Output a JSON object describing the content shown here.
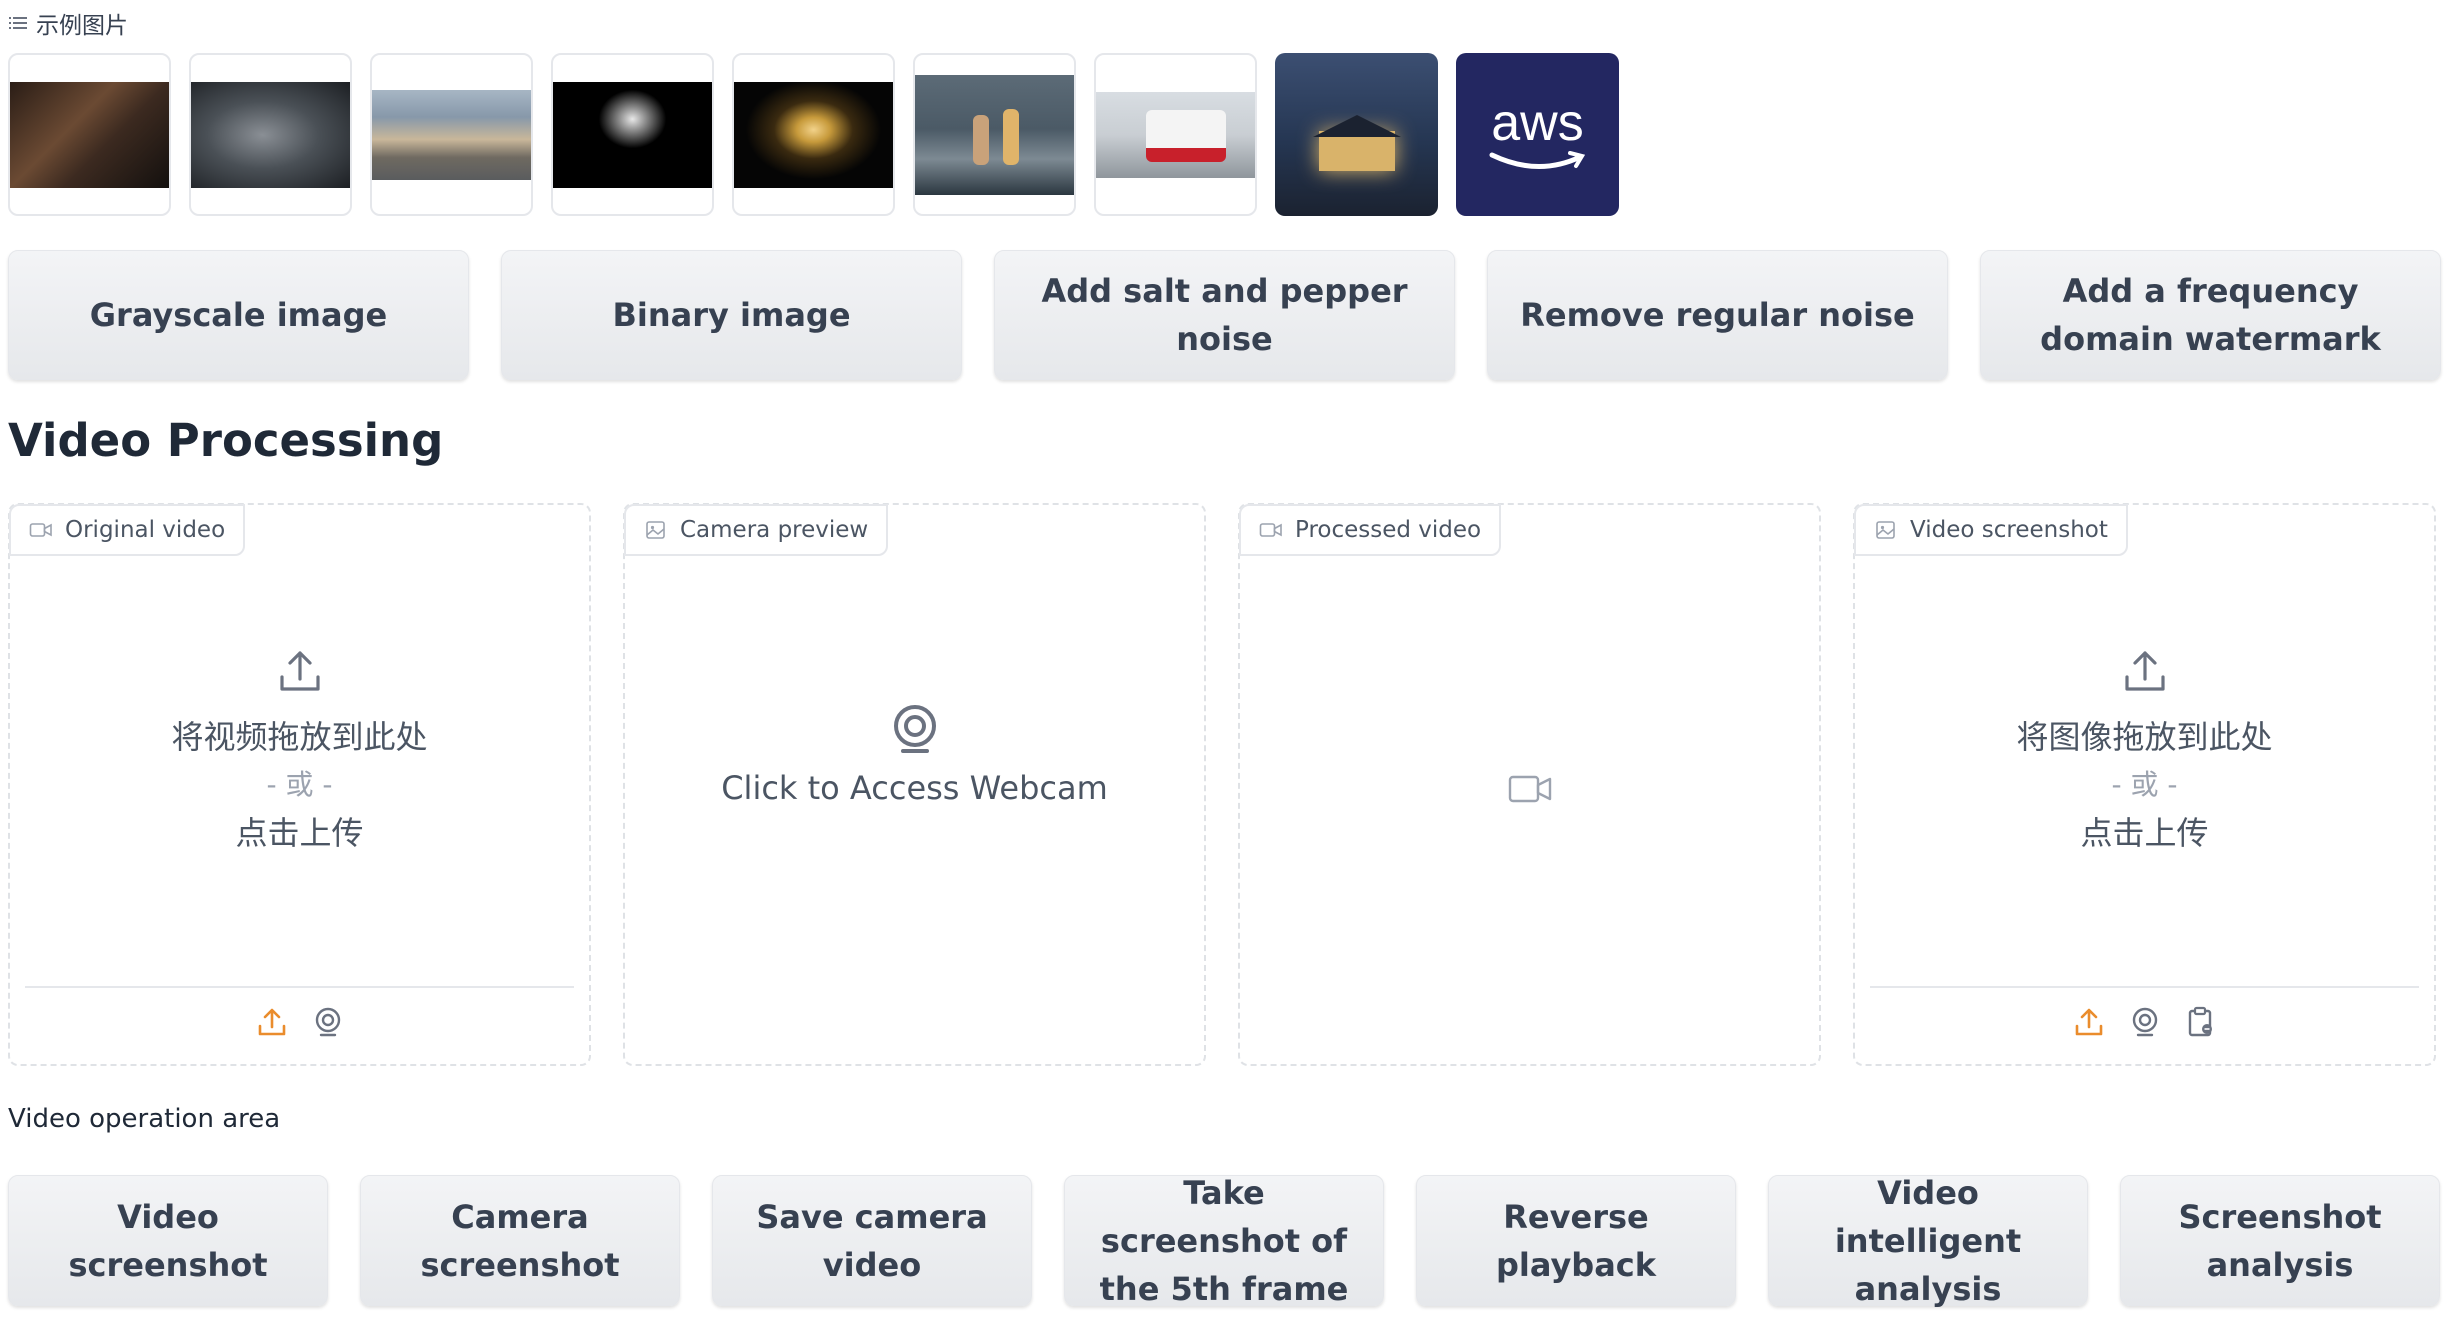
{
  "examples": {
    "label": "示例图片",
    "thumbnails": [
      {
        "name": "dark-room-photo",
        "colors": [
          "#2a1d16",
          "#6b4a33",
          "#13100e"
        ]
      },
      {
        "name": "map-photo",
        "colors": [
          "#3a3f45",
          "#8a8f95",
          "#1c1f23"
        ]
      },
      {
        "name": "city-photo",
        "colors": [
          "#8798aa",
          "#c9b79a",
          "#5a5c5e"
        ]
      },
      {
        "name": "flower-xray-photo",
        "colors": [
          "#000000",
          "#e8e8e8",
          "#000000"
        ]
      },
      {
        "name": "glass-photo",
        "colors": [
          "#050505",
          "#c79a3b",
          "#050505"
        ]
      },
      {
        "name": "toys-photo",
        "colors": [
          "#4b5a66",
          "#c9a27a",
          "#2b3740"
        ]
      },
      {
        "name": "tram-photo",
        "colors": [
          "#c9ced3",
          "#c8202b",
          "#8f969c"
        ]
      },
      {
        "name": "house-night-photo",
        "colors": [
          "#253652",
          "#d9b36a",
          "#1b2230"
        ]
      },
      {
        "name": "aws-logo",
        "text": "aws",
        "colors": [
          "#232761"
        ]
      }
    ]
  },
  "image_buttons": [
    {
      "label": "Grayscale image"
    },
    {
      "label": "Binary image"
    },
    {
      "label": "Add salt and pepper noise"
    },
    {
      "label": "Remove regular noise"
    },
    {
      "label": "Add a frequency domain watermark"
    }
  ],
  "video_section": {
    "title": "Video Processing",
    "panels": {
      "original": {
        "label": "Original video",
        "drop_main": "将视频拖放到此处",
        "drop_or": "- 或 -",
        "drop_click": "点击上传"
      },
      "camera": {
        "label": "Camera preview",
        "webcam_text": "Click to Access Webcam"
      },
      "processed": {
        "label": "Processed video"
      },
      "screenshot": {
        "label": "Video screenshot",
        "drop_main": "将图像拖放到此处",
        "drop_or": "- 或 -",
        "drop_click": "点击上传"
      }
    }
  },
  "operations": {
    "label": "Video operation area",
    "buttons": [
      {
        "label": "Video screenshot"
      },
      {
        "label": "Camera screenshot"
      },
      {
        "label": "Save camera video"
      },
      {
        "label": "Take screenshot of the 5th frame"
      },
      {
        "label": "Reverse playback"
      },
      {
        "label": "Video intelligent analysis"
      },
      {
        "label": "Screenshot analysis"
      }
    ]
  },
  "colors": {
    "accent": "#ea8c2c",
    "icon_gray": "#6b7280",
    "aws_bg": "#232761"
  }
}
